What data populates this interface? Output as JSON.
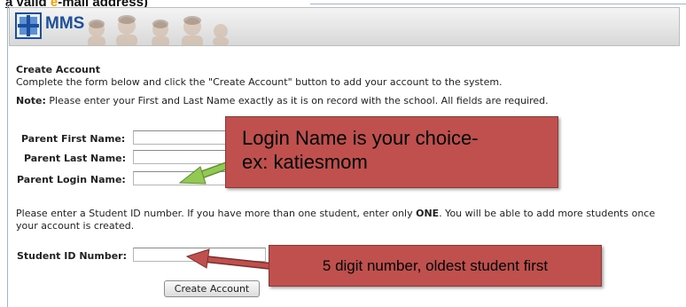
{
  "heading_fragment": {
    "before": "a valid ",
    "highlight": "e",
    "after": "-mail address)"
  },
  "header": {
    "logo_text": "MMS"
  },
  "intro": {
    "title": "Create Account",
    "description": "Complete the form below and click the \"Create Account\" button to add your account to the system."
  },
  "note": {
    "label": "Note:",
    "text": " Please enter your First and Last Name exactly as it is on record with the school. All fields are required."
  },
  "form": {
    "first_name_label": "Parent First Name:",
    "last_name_label": "Parent Last Name:",
    "login_name_label": "Parent Login Name:",
    "first_name_value": "",
    "last_name_value": "",
    "login_name_value": "",
    "student_instructions_before": "Please enter a Student ID number. If you have more than one student, enter only ",
    "student_instructions_emphasis": "ONE",
    "student_instructions_after": ". You will be able to add more students once your account is created.",
    "student_id_label": "Student ID Number:",
    "student_id_value": "",
    "submit_label": "Create Account"
  },
  "callouts": {
    "login_line1": "Login Name is your choice-",
    "login_line2": "ex: katiesmom",
    "student_id": "5 digit number, oldest student first"
  },
  "colors": {
    "callout_fill": "#c0504d",
    "green_arrow": "#92c955",
    "red_arrow": "#c0504d",
    "logo_blue": "#1e4f9c"
  }
}
